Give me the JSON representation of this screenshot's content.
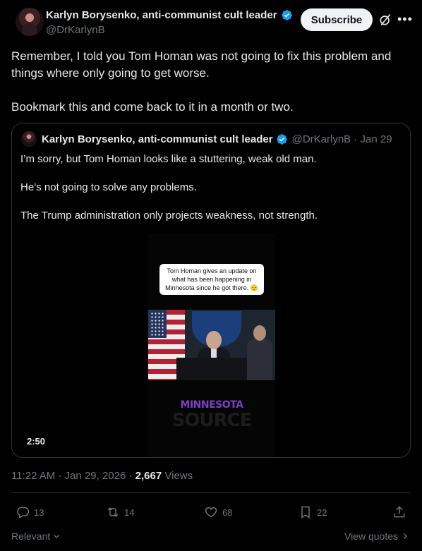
{
  "post": {
    "author_name": "Karlyn Borysenko, anti-communist cult leader",
    "handle": "@DrKarlynB",
    "subscribe_label": "Subscribe",
    "text_paragraphs": [
      "Remember, I told you Tom Homan was not going to fix this problem and things where only going to get worse.",
      "Bookmark this and come back to it in a month or two."
    ],
    "timestamp": "11:22 AM · Jan 29, 2026 · ",
    "views_count": "2,667",
    "views_label": " Views"
  },
  "quote": {
    "author_name": "Karlyn Borysenko, anti-communist cult leader",
    "handle_date": "@DrKarlynB · Jan 29",
    "paragraphs": [
      "I’m sorry, but Tom Homan looks like a stuttering, weak old man.",
      "He’s not going to solve any problems.",
      "The Trump administration only projects weakness, not strength."
    ],
    "video": {
      "caption": "Tom Homan gives an update on what has been happening in Minnesota since he got there. 🫡",
      "brand_top": "MINNESOTA",
      "brand_bottom": "SOURCE",
      "duration": "2:50"
    }
  },
  "actions": {
    "replies": "13",
    "reposts": "14",
    "likes": "68",
    "bookmarks": "22"
  },
  "footer": {
    "sort_label": "Relevant",
    "view_quotes_label": "View quotes"
  },
  "colors": {
    "background": "#000000",
    "text": "#e7e9ea",
    "muted": "#71767b",
    "verified": "#1d9bf0",
    "border": "#2f3336"
  }
}
